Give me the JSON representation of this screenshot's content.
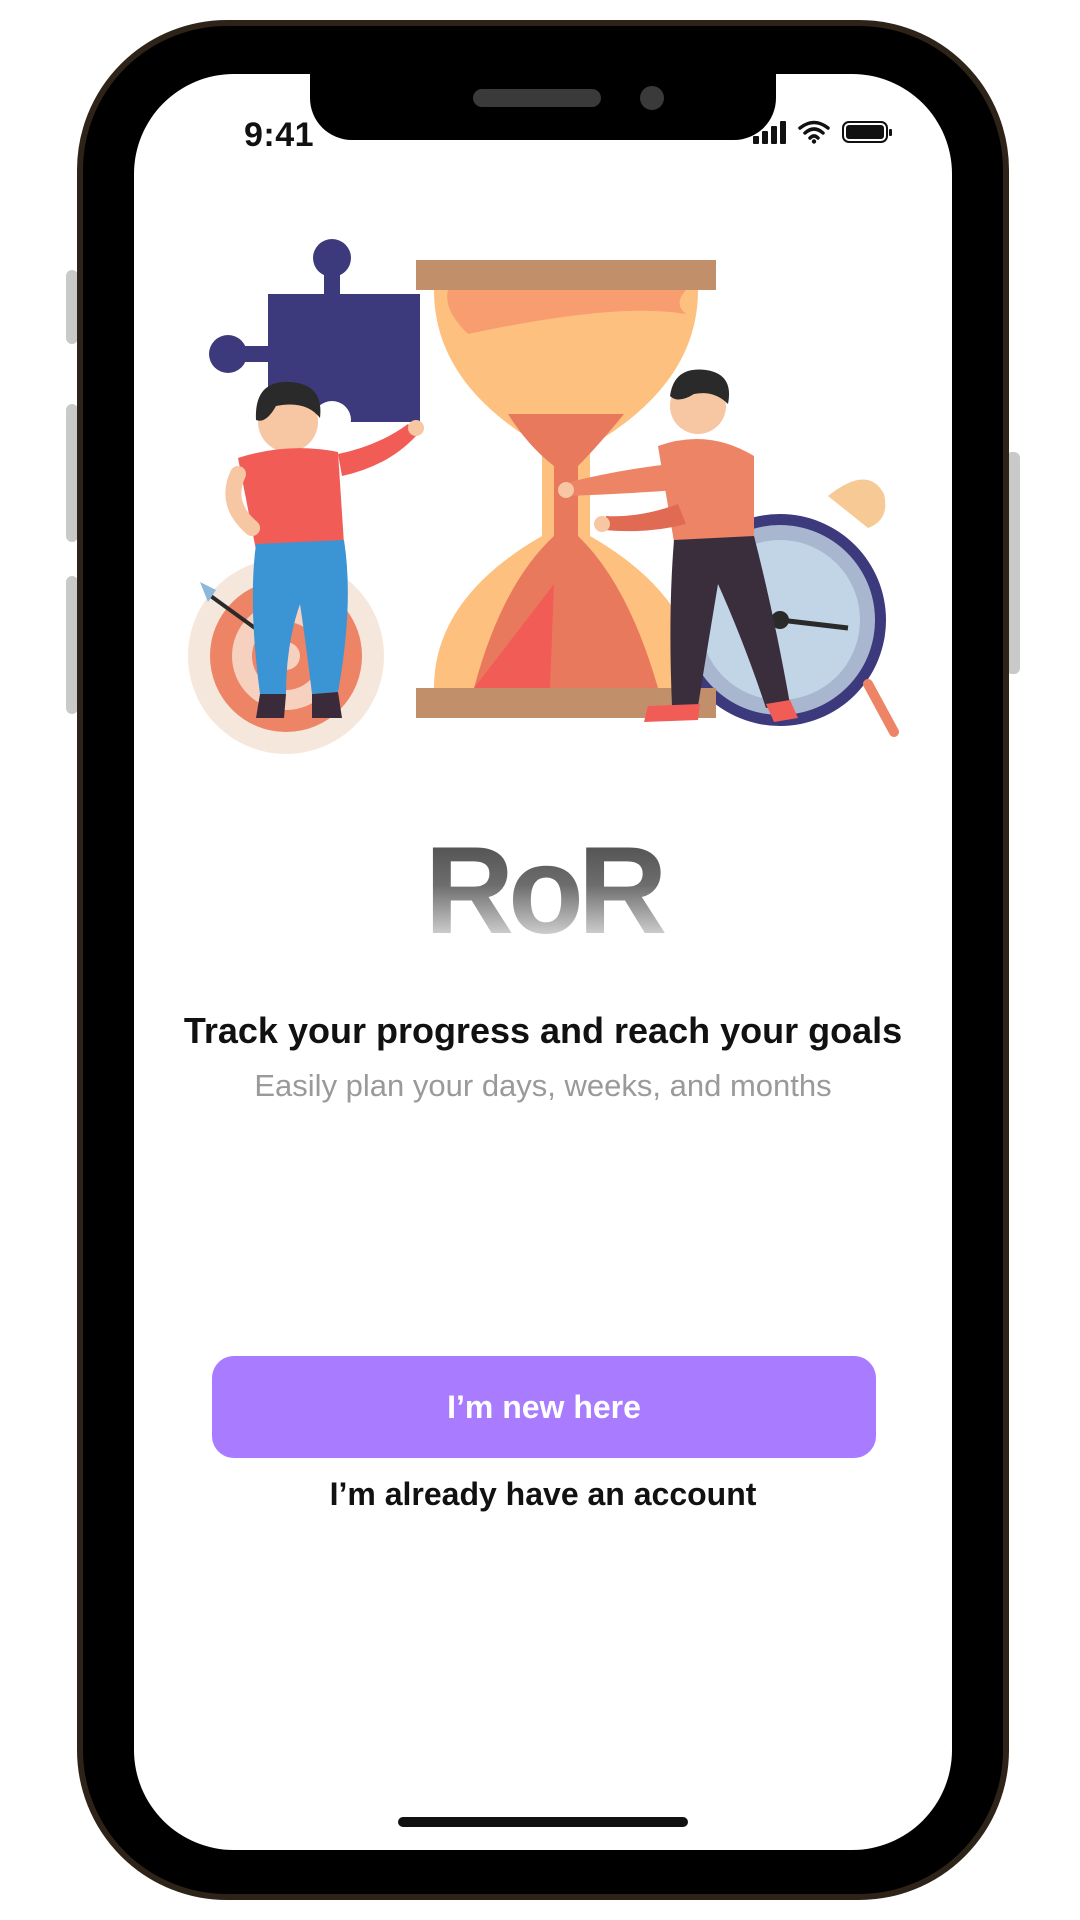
{
  "status_bar": {
    "time": "9:41",
    "icons": [
      "cellular-signal-icon",
      "wifi-icon",
      "battery-icon"
    ]
  },
  "hero": {
    "illustration": "hourglass-with-people-illustration",
    "logo_text": "RoR"
  },
  "onboarding": {
    "headline": "Track your progress and reach your goals",
    "subtitle": "Easily plan your days, weeks, and months"
  },
  "actions": {
    "primary_label": "I’m new here",
    "secondary_label": "I’m already have an account"
  },
  "colors": {
    "primary_button": "#a97bff",
    "headline_text": "#111111",
    "subtitle_text": "#9a9a9a",
    "illustration_sand": "#fdc07e",
    "illustration_sand_dark": "#e9795d",
    "illustration_navy": "#3c3a7c",
    "illustration_wood": "#c28f6b"
  }
}
